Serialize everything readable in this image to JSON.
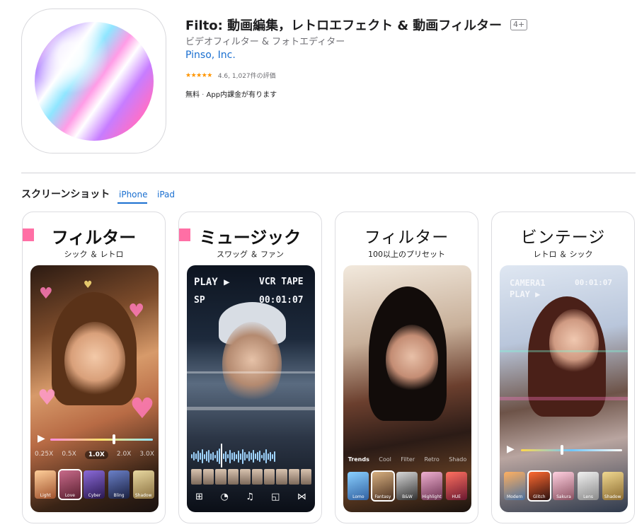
{
  "app": {
    "title": "Filto: 動画編集，レトロエフェクト & 動画フィルター",
    "age_rating": "4+",
    "subtitle": "ビデオフィルター & フォトエディター",
    "developer": "Pinso, Inc.",
    "stars": "★★★★★",
    "rating_text": "4.6, 1,027件の評価",
    "price": "無料",
    "separator": " · ",
    "iap": "App内課金が有ります"
  },
  "screenshots": {
    "heading": "スクリーンショット",
    "tabs": [
      "iPhone",
      "iPad"
    ],
    "cards": [
      {
        "title": "フィルター",
        "subtitle": "シック ＆ レトロ",
        "speeds": [
          "0.25X",
          "0.5X",
          "1.0X",
          "2.0X",
          "3.0X"
        ],
        "selected_speed": "1.0X",
        "thumbs": [
          "Light",
          "Love",
          "Cyber",
          "Bling",
          "Shadow"
        ]
      },
      {
        "title": "ミュージック",
        "subtitle": "スワッグ ＆ ファン",
        "vcr": {
          "play": "PLAY ▶",
          "tape": "VCR TAPE",
          "sp": "SP",
          "time": "00:01:07"
        }
      },
      {
        "title": "フィルター",
        "subtitle": "100以上のプリセット",
        "tabs": [
          "Trends",
          "Cool",
          "Filter",
          "Retro",
          "Shado"
        ],
        "thumbs": [
          "Lomo",
          "Fantasy",
          "B&W",
          "Highlight",
          "HUE"
        ]
      },
      {
        "title": "ビンテージ",
        "subtitle": "レトロ ＆ シック",
        "vcr": {
          "camera": "CAMERA1",
          "play": "PLAY ▶",
          "time": "00:01:07"
        },
        "thumbs": [
          "Modern",
          "Glitch",
          "Sakura",
          "Lens",
          "Shadow"
        ]
      }
    ]
  },
  "colors": {
    "link": "#1a6fd0",
    "star": "#ff9500",
    "accent_pink": "#ff6fa5"
  }
}
